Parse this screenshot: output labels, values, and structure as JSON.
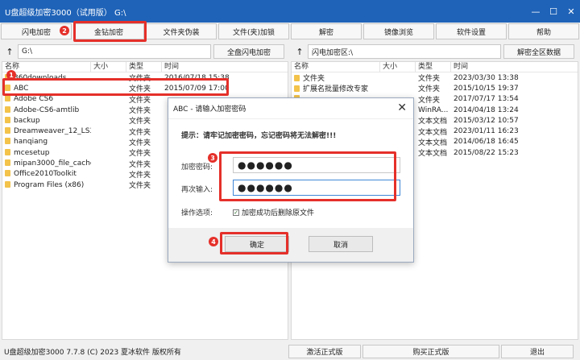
{
  "window": {
    "title": "U盘超级加密3000（试用版）  G:\\",
    "minimize": "—",
    "maximize": "☐",
    "close": "✕"
  },
  "toolbar": [
    "闪电加密",
    "金钻加密",
    "文件夹伪装",
    "文件(夹)加锁",
    "解密",
    "镜像浏览",
    "软件设置",
    "帮助"
  ],
  "left_pane": {
    "path": "G:\\",
    "action_button": "全盘闪电加密",
    "columns": [
      "名称",
      "大小",
      "类型",
      "时间"
    ],
    "rows": [
      {
        "name": "360downloads",
        "type": "文件夹",
        "time": "2016/07/18 15:38"
      },
      {
        "name": "ABC",
        "type": "文件夹",
        "time": "2015/07/09 17:00"
      },
      {
        "name": "Adobe CS6",
        "type": "文件夹",
        "time": ""
      },
      {
        "name": "Adobe-CS6-amtlib",
        "type": "文件夹",
        "time": ""
      },
      {
        "name": "backup",
        "type": "文件夹",
        "time": ""
      },
      {
        "name": "Dreamweaver_12_LS3",
        "type": "文件夹",
        "time": ""
      },
      {
        "name": "hanqiang",
        "type": "文件夹",
        "time": ""
      },
      {
        "name": "mcesetup",
        "type": "文件夹",
        "time": ""
      },
      {
        "name": "mipan3000_file_cache",
        "type": "文件夹",
        "time": ""
      },
      {
        "name": "Office2010Toolkit",
        "type": "文件夹",
        "time": ""
      },
      {
        "name": "Program Files (x86)",
        "type": "文件夹",
        "time": ""
      }
    ]
  },
  "right_pane": {
    "path": "闪电加密区:\\",
    "action_button": "解密全区数据",
    "columns": [
      "名称",
      "大小",
      "类型",
      "时间"
    ],
    "rows": [
      {
        "name": "文件夹",
        "type": "文件夹",
        "time": "2023/03/30 13:38"
      },
      {
        "name": "扩展名批量修改专家",
        "type": "文件夹",
        "time": "2015/10/15 19:37"
      },
      {
        "name": "",
        "type": "文件夹",
        "time": "2017/07/17 13:54"
      },
      {
        "name": "",
        "type": "WinRA...",
        "time": "2014/04/18 13:24"
      },
      {
        "name": "",
        "type": "文本文档",
        "time": "2015/03/12 10:57"
      },
      {
        "name": "",
        "type": "文本文档",
        "time": "2023/01/11 16:23"
      },
      {
        "name": "",
        "type": "文本文档",
        "time": "2014/06/18 16:45"
      },
      {
        "name": "",
        "type": "文本文档",
        "time": "2015/08/22 15:23"
      }
    ]
  },
  "dialog": {
    "title": "ABC - 请输入加密密码",
    "hint": "提示：请牢记加密密码，忘记密码将无法解密!!!",
    "password_label": "加密密码:",
    "password_value": "●●●●●●",
    "confirm_label": "再次输入:",
    "confirm_value": "●●●●●●",
    "option_label": "操作选项:",
    "option_checkbox": "加密成功后删除原文件",
    "ok": "确定",
    "cancel": "取消"
  },
  "status": {
    "text": "U盘超级加密3000 7.7.8 (C) 2023 夏冰软件 版权所有",
    "buttons": [
      "激活正式版",
      "购买正式版",
      "退出"
    ]
  },
  "badges": [
    "1",
    "2",
    "3",
    "4"
  ],
  "colors": {
    "titlebar": "#1f63b8",
    "highlight": "#e5302a",
    "folder": "#f3c34a"
  }
}
